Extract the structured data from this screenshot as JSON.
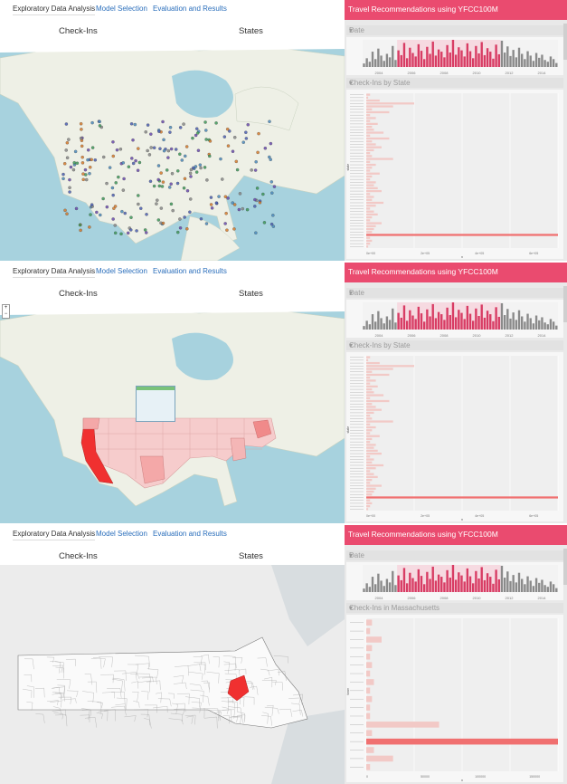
{
  "nav": {
    "tab_eda": "Exploratory Data Analysis",
    "tab_model": "Model Selection",
    "tab_eval": "Evaluation and Results"
  },
  "subheads": {
    "checkins": "Check-Ins",
    "states": "States"
  },
  "right_panel": {
    "title": "Travel Recommendations using YFCC100M",
    "date_label": "Date",
    "state_chart_label": "Check-Ins by State",
    "mass_chart_label": "Check-Ins in Massachusetts"
  },
  "colors": {
    "accent": "#ea4b6f",
    "bar_light": "#f2c9c6",
    "bar_strong": "#f07070",
    "date_bar_pink": "#d83c64",
    "date_bar_gray": "#8a8a8a"
  },
  "icons": {
    "zoom_control": "zoom-control-icon",
    "collapse": "chevron-down-icon"
  },
  "chart_data": [
    {
      "type": "bar",
      "title": "Date",
      "xlabel": "",
      "ylabel": "",
      "x_ticks": [
        "2004",
        "2006",
        "2008",
        "2010",
        "2012",
        "2014"
      ],
      "selection_range": [
        "2007",
        "2012"
      ],
      "values": [
        8,
        20,
        12,
        35,
        18,
        42,
        26,
        14,
        30,
        22,
        48,
        16,
        38,
        27,
        55,
        20,
        44,
        32,
        24,
        52,
        37,
        18,
        46,
        30,
        58,
        26,
        40,
        35,
        22,
        50,
        33,
        62,
        28,
        45,
        38,
        24,
        54,
        36,
        20,
        48,
        31,
        57,
        27,
        43,
        35,
        19,
        51,
        29,
        60,
        33,
        47,
        25,
        39,
        22,
        44,
        30,
        18,
        36,
        26,
        14,
        32,
        21,
        28,
        16,
        12,
        24,
        18,
        9
      ]
    },
    {
      "type": "bar",
      "orientation": "horizontal",
      "title": "Check-Ins by State",
      "ylabel": "state",
      "xlabel": "n",
      "x_ticks": [
        "0e+00",
        "2e+05",
        "4e+05",
        "6e+05"
      ],
      "values": [
        0.02,
        0.01,
        0.07,
        0.25,
        0.14,
        0.03,
        0.12,
        0.02,
        0.05,
        0.02,
        0.06,
        0.03,
        0.04,
        0.09,
        0.02,
        0.12,
        0.03,
        0.05,
        0.08,
        0.04,
        0.02,
        0.03,
        0.14,
        0.02,
        0.05,
        0.03,
        0.02,
        0.07,
        0.03,
        0.02,
        0.05,
        0.04,
        0.06,
        0.08,
        0.02,
        0.04,
        0.03,
        0.09,
        0.05,
        0.02,
        0.04,
        0.06,
        0.03,
        0.02,
        0.08,
        0.05,
        0.04,
        0.03,
        1.0,
        0.02,
        0.03,
        0.02,
        0.01
      ]
    },
    {
      "type": "bar",
      "orientation": "horizontal",
      "title": "Check-Ins in Massachusetts",
      "ylabel": "town",
      "xlabel": "n",
      "x_ticks": [
        "0",
        "50000",
        "100000",
        "150000"
      ],
      "values": [
        0.03,
        0.02,
        0.08,
        0.03,
        0.02,
        0.03,
        0.02,
        0.04,
        0.02,
        0.03,
        0.02,
        0.02,
        0.38,
        0.03,
        1.0,
        0.04,
        0.14,
        0.02
      ]
    }
  ]
}
